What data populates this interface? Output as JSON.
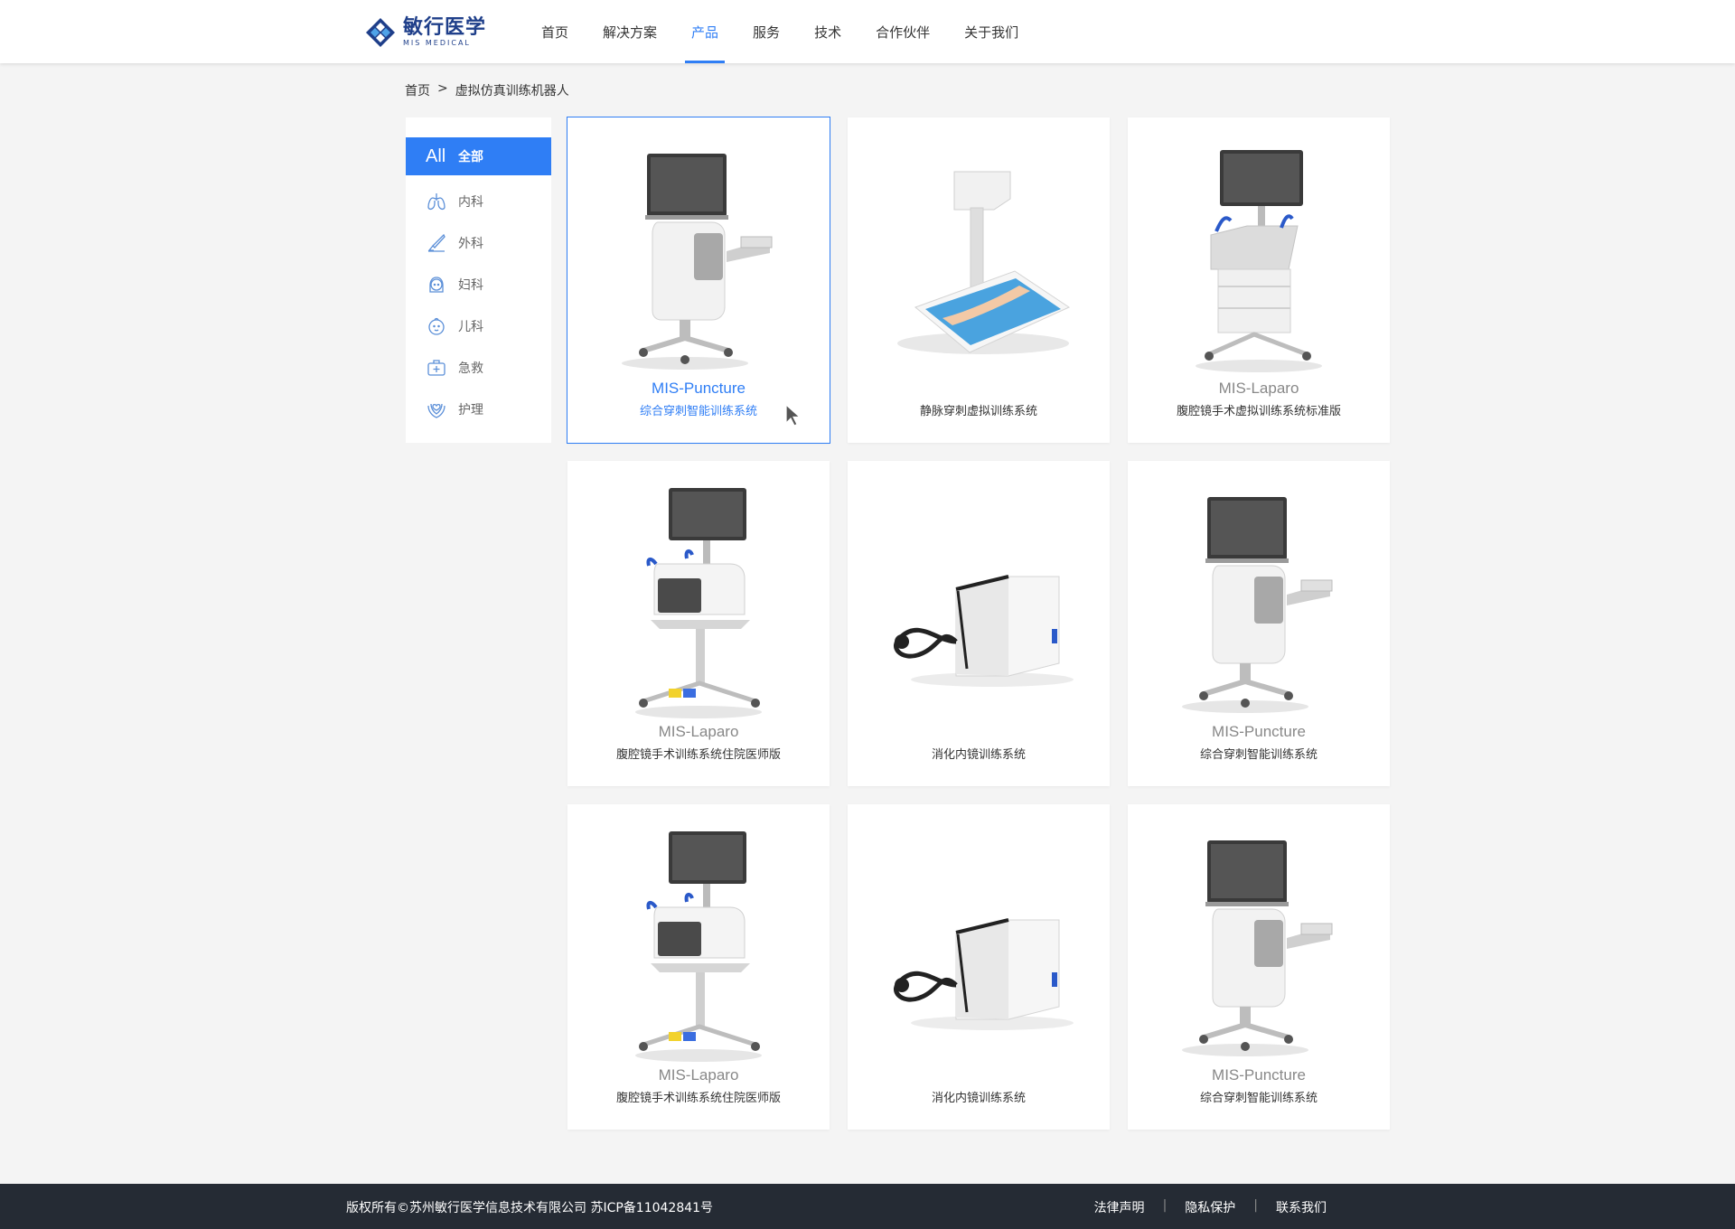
{
  "header": {
    "logo_cn": "敏行医学",
    "logo_en": "MIS MEDICAL",
    "nav": [
      {
        "label": "首页"
      },
      {
        "label": "解决方案"
      },
      {
        "label": "产品"
      },
      {
        "label": "服务"
      },
      {
        "label": "技术"
      },
      {
        "label": "合作伙伴"
      },
      {
        "label": "关于我们"
      }
    ],
    "active_nav": "产品"
  },
  "breadcrumb": {
    "home": "首页",
    "separator": ">",
    "current": "虚拟仿真训练机器人"
  },
  "sidebar": {
    "items": [
      {
        "icon": "All",
        "label": "全部",
        "active": true
      },
      {
        "icon": "lungs-icon",
        "label": "内科"
      },
      {
        "icon": "scalpel-icon",
        "label": "外科"
      },
      {
        "icon": "woman-face-icon",
        "label": "妇科"
      },
      {
        "icon": "baby-face-icon",
        "label": "儿科"
      },
      {
        "icon": "first-aid-kit-icon",
        "label": "急救"
      },
      {
        "icon": "caring-hands-icon",
        "label": "护理"
      }
    ]
  },
  "products": [
    {
      "model": "MIS-Puncture",
      "desc": "综合穿刺智能训练系统",
      "image": "puncture-cart",
      "active": true
    },
    {
      "model": "",
      "desc": "静脉穿刺虚拟训练系统",
      "image": "vein-projector"
    },
    {
      "model": "MIS-Laparo",
      "desc": "腹腔镜手术虚拟训练系统标准版",
      "image": "laparo-standard"
    },
    {
      "model": "MIS-Laparo",
      "desc": "腹腔镜手术训练系统住院医师版",
      "image": "laparo-resident"
    },
    {
      "model": "",
      "desc": "消化内镜训练系统",
      "image": "endo-box"
    },
    {
      "model": "MIS-Puncture",
      "desc": "综合穿刺智能训练系统",
      "image": "puncture-cart"
    },
    {
      "model": "MIS-Laparo",
      "desc": "腹腔镜手术训练系统住院医师版",
      "image": "laparo-resident"
    },
    {
      "model": "",
      "desc": "消化内镜训练系统",
      "image": "endo-box"
    },
    {
      "model": "MIS-Puncture",
      "desc": "综合穿刺智能训练系统",
      "image": "puncture-cart"
    }
  ],
  "footer": {
    "copyright": "版权所有©苏州敏行医学信息技术有限公司  苏ICP备11042841号",
    "links": [
      "法律声明",
      "隐私保护",
      "联系我们"
    ],
    "separator": "|"
  },
  "colors": {
    "accent": "#2f7ef5",
    "brand": "#1f3f8a",
    "footer_bg": "#252b34",
    "page_bg": "#f4f4f4"
  }
}
